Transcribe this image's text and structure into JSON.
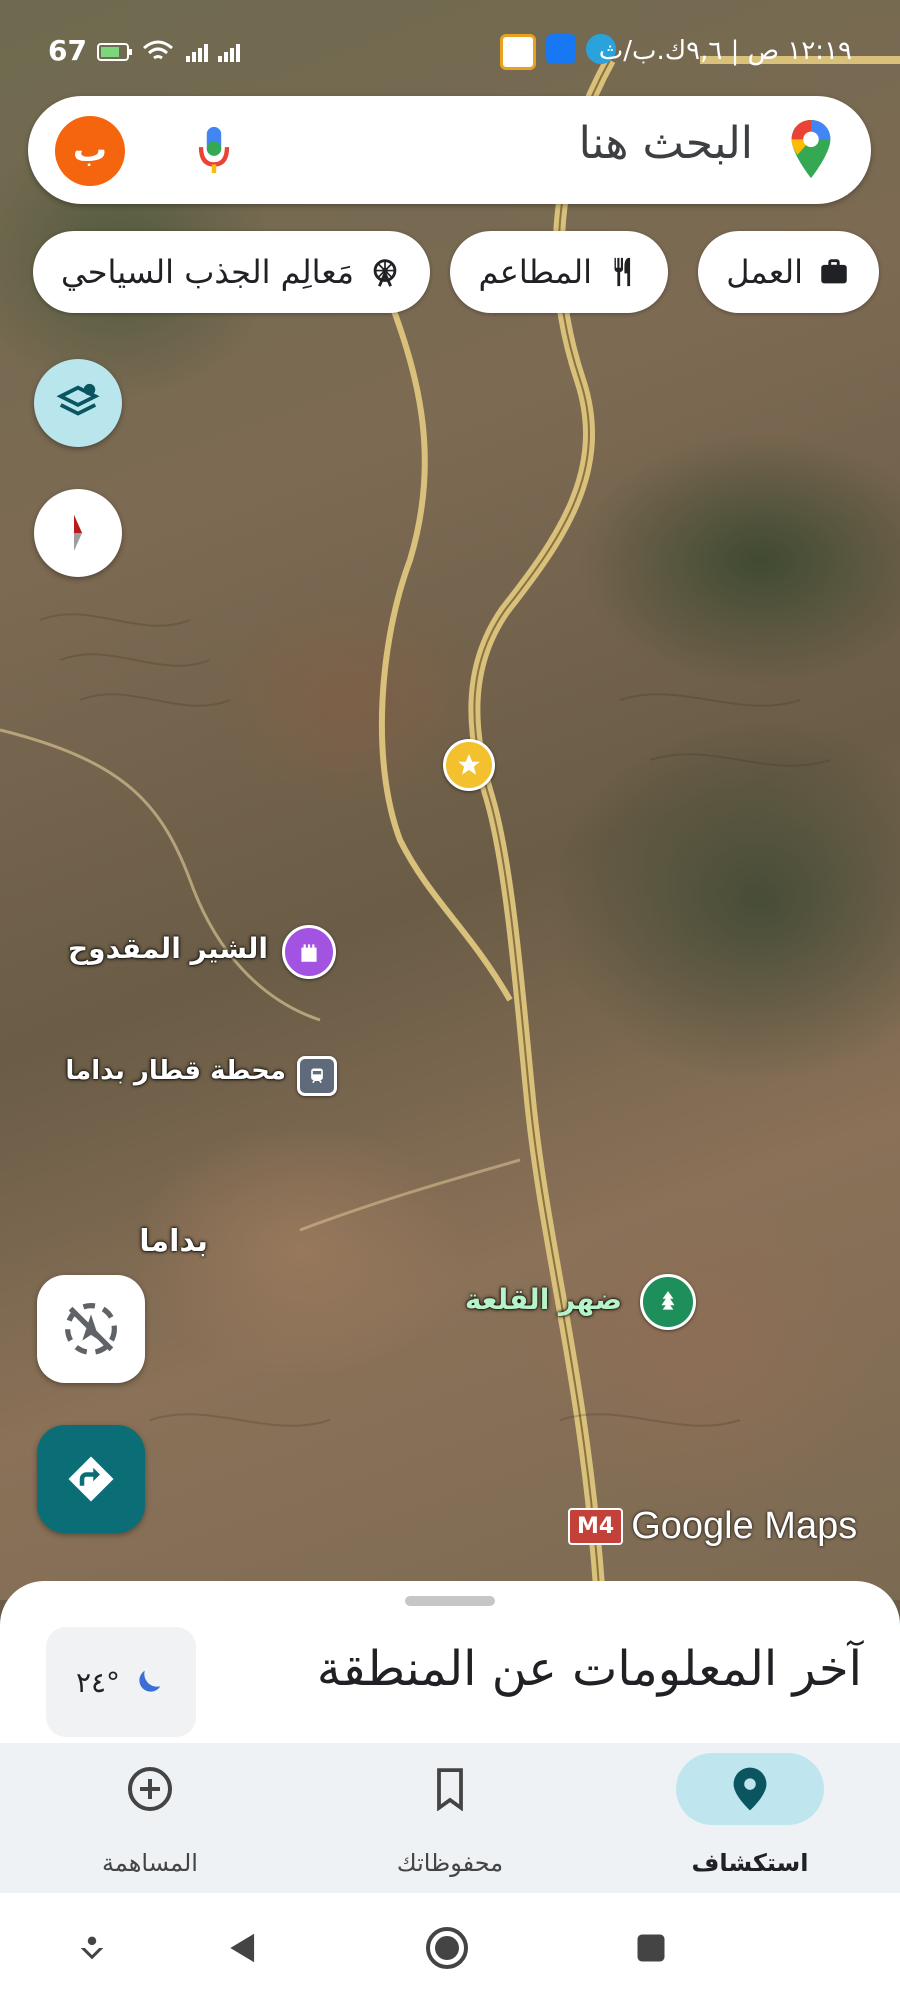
{
  "status_bar": {
    "battery": "67",
    "time": "١٢:١٩ ص | ٩,٦ك.ب/ث"
  },
  "search": {
    "placeholder": "البحث هنا",
    "avatar_letter": "ب"
  },
  "chips": [
    {
      "label": "العمل",
      "icon": "briefcase-icon"
    },
    {
      "label": "المطاعم",
      "icon": "fork-knife-icon"
    },
    {
      "label": "مَعالِم الجذب السياحي",
      "icon": "ferris-wheel-icon"
    }
  ],
  "map": {
    "labels": {
      "shir": "الشير المقدوح",
      "station": "محطة قطار بداما",
      "town": "بداما",
      "dahr": "ضهر القلعة"
    },
    "road_badge": "M4",
    "watermark": "Google Maps"
  },
  "sheet": {
    "title": "آخر المعلومات عن المنطقة",
    "weather_temp": "٢٤°",
    "weather_icon": "moon-icon"
  },
  "nav": [
    {
      "label": "استكشاف",
      "icon": "explore-pin-icon",
      "active": true
    },
    {
      "label": "محفوظاتك",
      "icon": "bookmark-icon",
      "active": false
    },
    {
      "label": "المساهمة",
      "icon": "add-circle-icon",
      "active": false
    }
  ],
  "colors": {
    "accent": "#0b6e76",
    "avatar": "#f4650e",
    "nav_active_bg": "#bfe6ee"
  }
}
